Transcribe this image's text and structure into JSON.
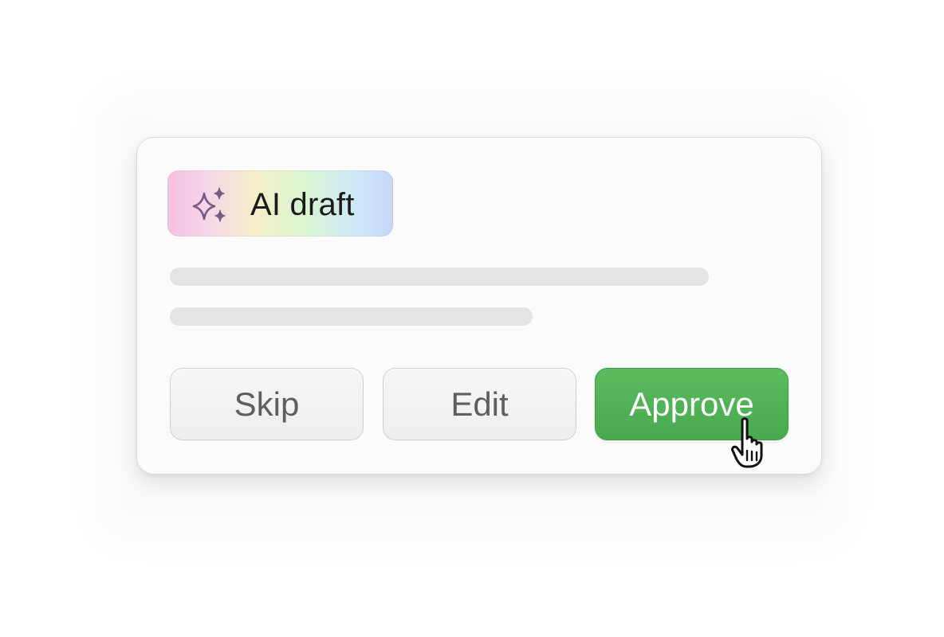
{
  "card": {
    "badge": {
      "icon": "sparkles-icon",
      "label": "AI draft"
    },
    "placeholder_lines": 2,
    "actions": {
      "skip_label": "Skip",
      "edit_label": "Edit",
      "approve_label": "Approve"
    }
  },
  "cursor": {
    "icon": "hand-pointer-icon"
  },
  "colors": {
    "approve": "#4cad52",
    "placeholder": "#e4e4e4",
    "icon_purple": "#7b5a86"
  }
}
